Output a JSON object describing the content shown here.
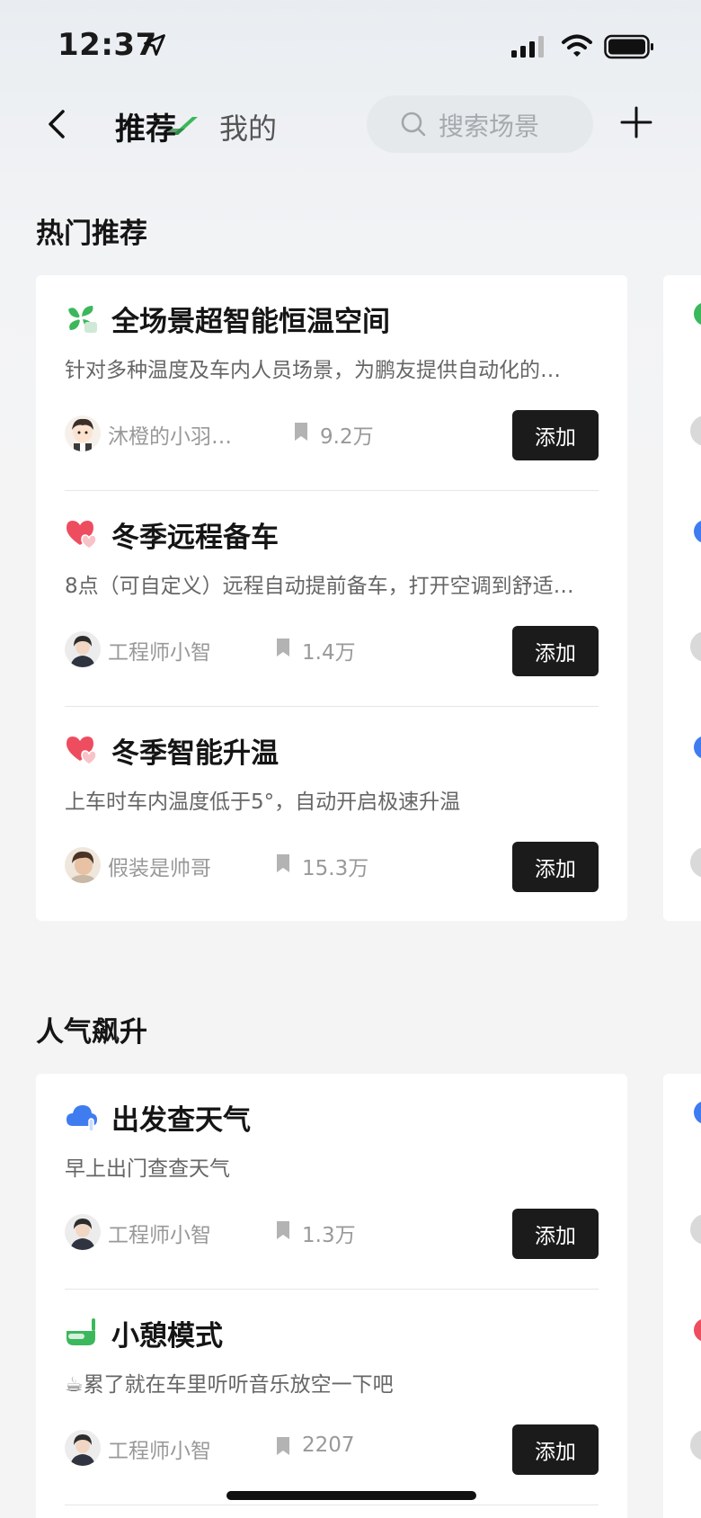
{
  "status_bar": {
    "time": "12:37"
  },
  "nav": {
    "tab_recommend": "推荐",
    "tab_mine": "我的",
    "search_placeholder": "搜索场景"
  },
  "sections": [
    {
      "title": "热门推荐",
      "items": [
        {
          "title": "全场景超智能恒温空间",
          "desc": "针对多种温度及车内人员场景，为鹏友提供自动化的…",
          "author": "沐橙的小羽…",
          "count": "9.2万",
          "add_label": "添加",
          "icon": "fan-icon",
          "avatar": "cartoon-avatar"
        },
        {
          "title": "冬季远程备车",
          "desc": "8点（可自定义）远程自动提前备车，打开空调到舒适…",
          "author": "工程师小智",
          "count": "1.4万",
          "add_label": "添加",
          "icon": "heart-icon",
          "avatar": "engineer-avatar"
        },
        {
          "title": "冬季智能升温",
          "desc": "上车时车内温度低于5°，自动开启极速升温",
          "author": "假装是帅哥",
          "count": "15.3万",
          "add_label": "添加",
          "icon": "heart-icon",
          "avatar": "user-avatar"
        }
      ]
    },
    {
      "title": "人气飙升",
      "items": [
        {
          "title": "出发查天气",
          "desc": "早上出门查查天气",
          "author": "工程师小智",
          "count": "1.3万",
          "add_label": "添加",
          "icon": "cloud-icon",
          "avatar": "engineer-avatar"
        },
        {
          "title": "小憩模式",
          "desc": "☕累了就在车里听听音乐放空一下吧",
          "author": "工程师小智",
          "count": "2207",
          "add_label": "添加",
          "icon": "bathtub-icon",
          "avatar": "engineer-avatar"
        }
      ]
    }
  ],
  "colors": {
    "accent_green": "#3bb85c",
    "button_dark": "#1b1b1b",
    "heart_red": "#ee4d5f",
    "cloud_blue": "#3f7cf0"
  }
}
